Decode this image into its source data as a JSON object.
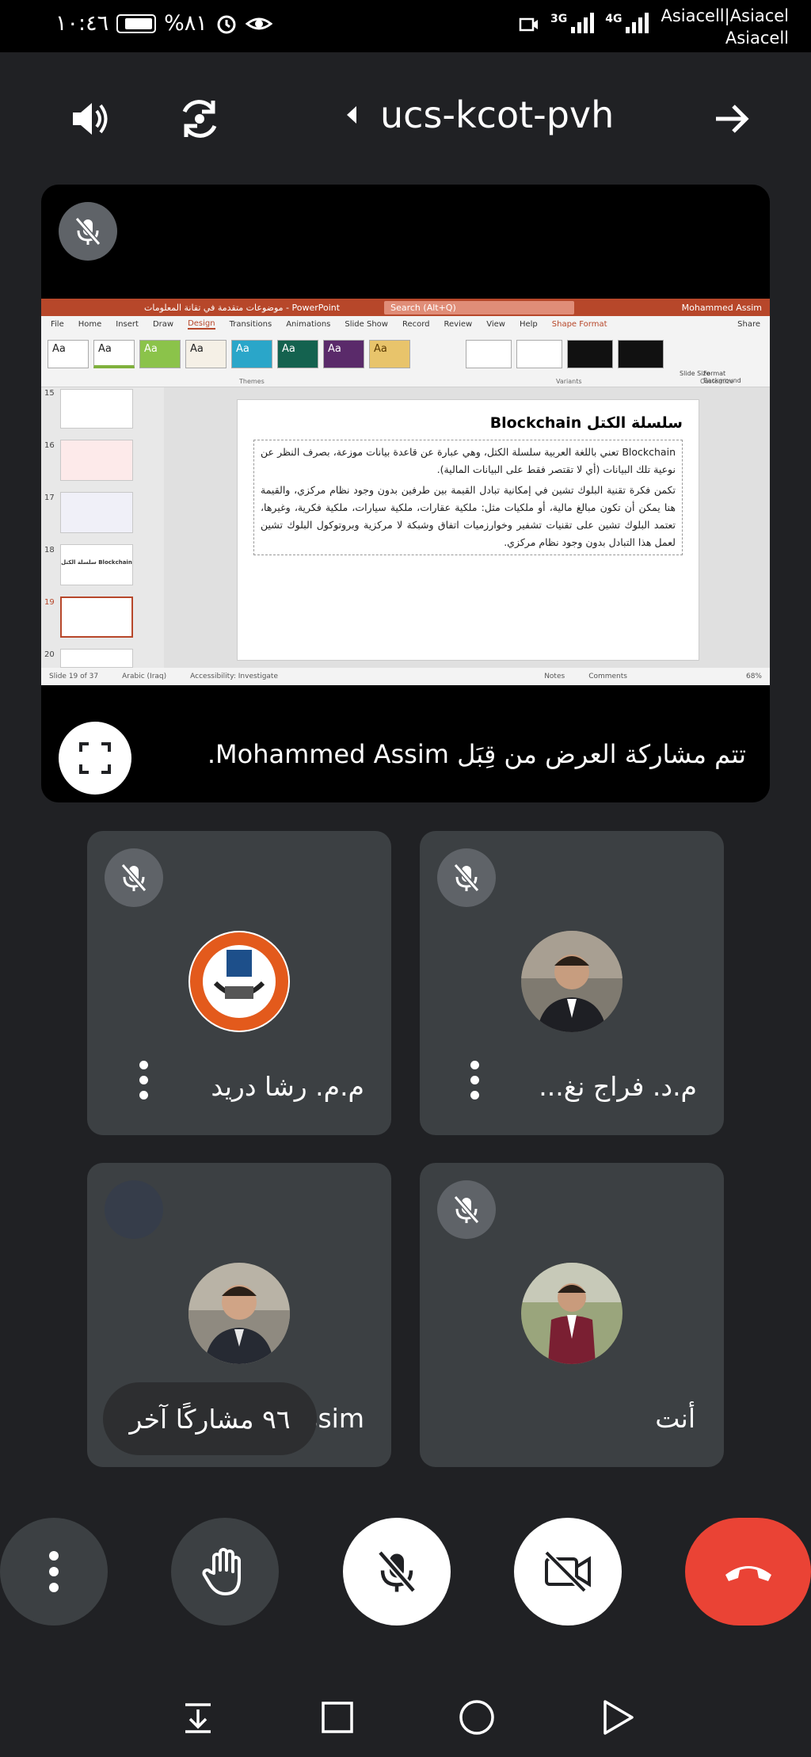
{
  "status_bar": {
    "time": "١٠:٤٦",
    "battery": "%٨١",
    "network_3g": "3G",
    "network_4g": "4G",
    "carrier_line1": "Asiacell|Asiacel",
    "carrier_line2": "Asiacell"
  },
  "top_bar": {
    "meeting_code": "ucs-kcot-pvh"
  },
  "presentation": {
    "shared_by_text": "تتم مشاركة العرض من قِبَل Mohammed Assim.",
    "ppt": {
      "window_title": "موضوعات متقدمة في تقانة المعلومات - PowerPoint",
      "search_placeholder": "Search (Alt+Q)",
      "user": "Mohammed Assim",
      "tabs": [
        "File",
        "Home",
        "Insert",
        "Draw",
        "Design",
        "Transitions",
        "Animations",
        "Slide Show",
        "Record",
        "Review",
        "View",
        "Help",
        "Shape Format"
      ],
      "share": "Share",
      "group_themes": "Themes",
      "group_variants": "Variants",
      "group_customize": "Customize",
      "theme_label": "Aa",
      "slide_size": "Slide Size",
      "format_background": "Format Background",
      "slide_numbers": [
        "15",
        "16",
        "17",
        "18",
        "19",
        "20"
      ],
      "thumb18_text": "سلسلة الكتل Blockchain",
      "slide_title": "سلسلة الكتل Blockchain",
      "bullet1": "Blockchain تعني باللغة العربية سلسلة الكتل، وهي عبارة عن قاعدة بيانات موزعة، بصرف النظر عن نوعية تلك البيانات (أي لا تقتصر فقط على البيانات المالية).",
      "bullet2": "تكمن فكرة تقنية البلوك تشين في إمكانية تبادل القيمة بين طرفين بدون وجود نظام مركزي، والقيمة هنا يمكن أن تكون مبالغ مالية، أو ملكيات مثل: ملكية عقارات، ملكية سيارات، ملكية فكرية، وغيرها، تعتمد البلوك تشين على تقنيات تشفير وخوارزميات اتفاق وشبكة لا مركزية وبروتوكول البلوك تشين لعمل هذا التبادل بدون وجود نظام مركزي.",
      "status_slide": "Slide 19 of 37",
      "status_lang": "Arabic (Iraq)",
      "status_access": "Accessibility: Investigate",
      "status_notes": "Notes",
      "status_comments": "Comments",
      "status_zoom": "68%"
    }
  },
  "participants": [
    {
      "name": "م.م. رشا دريد"
    },
    {
      "name": "م.د. فراج نغ..."
    },
    {
      "name": "Mohammed Assim"
    },
    {
      "name": "أنت"
    }
  ],
  "others_chip": "٩٦ مشاركًا آخر",
  "colors": {
    "background": "#202124",
    "tile": "#3c4043",
    "mute_badge": "#5f6368",
    "hangup": "#ea4335",
    "ppt_accent": "#b7472a"
  }
}
